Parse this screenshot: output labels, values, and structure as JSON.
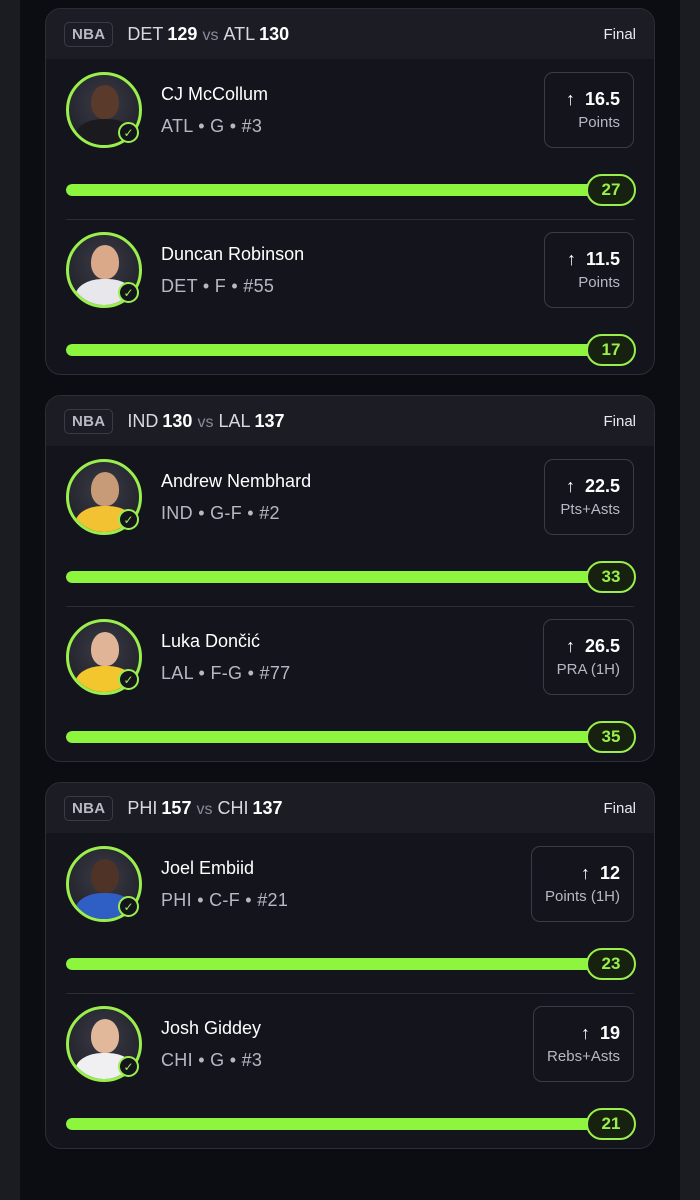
{
  "games": [
    {
      "league": "NBA",
      "home_team": "DET",
      "home_score": "129",
      "vs": "vs",
      "away_team": "ATL",
      "away_score": "130",
      "status": "Final",
      "players": [
        {
          "name": "CJ McCollum",
          "meta": "ATL • G • #3",
          "line": "16.5",
          "stat": "Points",
          "result": "27",
          "progress": 1.0,
          "skin": "#5a3a2a",
          "jersey": "#1b1b1f"
        },
        {
          "name": "Duncan Robinson",
          "meta": "DET • F • #55",
          "line": "11.5",
          "stat": "Points",
          "result": "17",
          "progress": 1.0,
          "skin": "#d9a98a",
          "jersey": "#e8e8ec"
        }
      ]
    },
    {
      "league": "NBA",
      "home_team": "IND",
      "home_score": "130",
      "vs": "vs",
      "away_team": "LAL",
      "away_score": "137",
      "status": "Final",
      "players": [
        {
          "name": "Andrew Nembhard",
          "meta": "IND • G-F • #2",
          "line": "22.5",
          "stat": "Pts+Asts",
          "result": "33",
          "progress": 1.0,
          "skin": "#c79a78",
          "jersey": "#f2c233"
        },
        {
          "name": "Luka Dončić",
          "meta": "LAL • F-G • #77",
          "line": "26.5",
          "stat": "PRA (1H)",
          "result": "35",
          "progress": 1.0,
          "skin": "#e0b597",
          "jersey": "#f4c62e"
        }
      ]
    },
    {
      "league": "NBA",
      "home_team": "PHI",
      "home_score": "157",
      "vs": "vs",
      "away_team": "CHI",
      "away_score": "137",
      "status": "Final",
      "players": [
        {
          "name": "Joel Embiid",
          "meta": "PHI • C-F • #21",
          "line": "12",
          "stat": "Points (1H)",
          "result": "23",
          "progress": 1.0,
          "skin": "#4e3326",
          "jersey": "#2f5fc4"
        },
        {
          "name": "Josh Giddey",
          "meta": "CHI • G • #3",
          "line": "19",
          "stat": "Rebs+Asts",
          "result": "21",
          "progress": 1.0,
          "skin": "#e2b89a",
          "jersey": "#f0f0f2"
        }
      ]
    }
  ],
  "icons": {
    "check": "check-icon",
    "arrow": "arrow-up-icon"
  },
  "colors": {
    "accent": "#8ef53f",
    "background": "#0c0d12",
    "card": "#14151c"
  }
}
